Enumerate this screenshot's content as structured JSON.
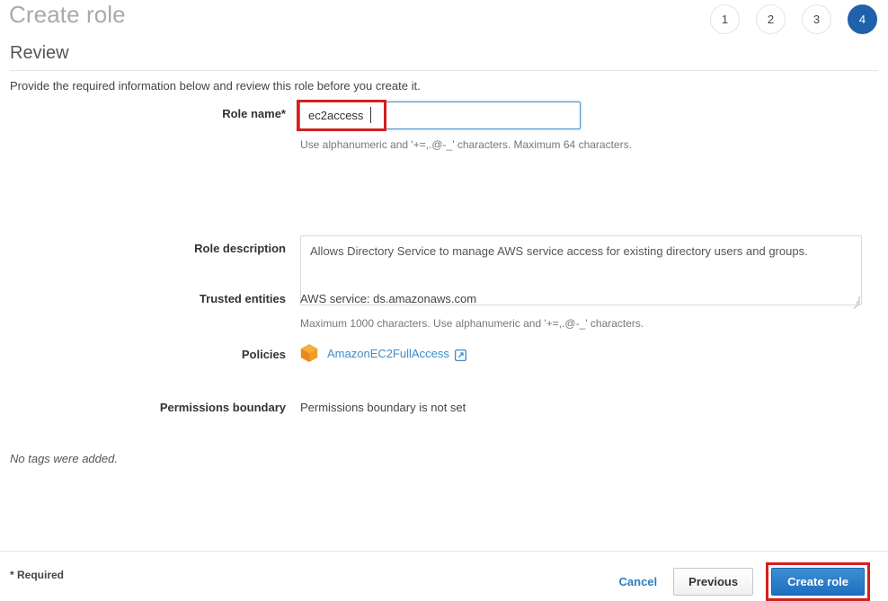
{
  "header": {
    "title": "Create role",
    "steps": [
      {
        "label": "1",
        "active": false
      },
      {
        "label": "2",
        "active": false
      },
      {
        "label": "3",
        "active": false
      },
      {
        "label": "4",
        "active": true
      }
    ]
  },
  "section": {
    "title": "Review",
    "intro": "Provide the required information below and review this role before you create it."
  },
  "form": {
    "role_name": {
      "label": "Role name*",
      "value": "ec2access",
      "placeholder": "",
      "hint": "Use alphanumeric and '+=,.@-_' characters. Maximum 64 characters."
    },
    "role_description": {
      "label": "Role description",
      "value": "Allows Directory Service to manage AWS service access for existing directory users and groups.",
      "placeholder": "",
      "hint": "Maximum 1000 characters. Use alphanumeric and '+=,.@-_' characters."
    },
    "trusted_entities": {
      "label": "Trusted entities",
      "value": "AWS service: ds.amazonaws.com"
    },
    "policies": {
      "label": "Policies",
      "items": [
        {
          "name": "AmazonEC2FullAccess",
          "icon": "policy-cube-icon",
          "external_link_icon": "external-link-icon"
        }
      ]
    },
    "permissions_boundary": {
      "label": "Permissions boundary",
      "value": "Permissions boundary is not set"
    },
    "tags_note": "No tags were added."
  },
  "footer": {
    "required_note": "* Required",
    "cancel_label": "Cancel",
    "previous_label": "Previous",
    "create_label": "Create role"
  },
  "colors": {
    "accent_blue": "#1f62ab",
    "link_blue": "#3b8ccb",
    "annotation_red": "#d32020",
    "policy_orange": "#f2931f",
    "title_gray": "#aaaaaa"
  }
}
